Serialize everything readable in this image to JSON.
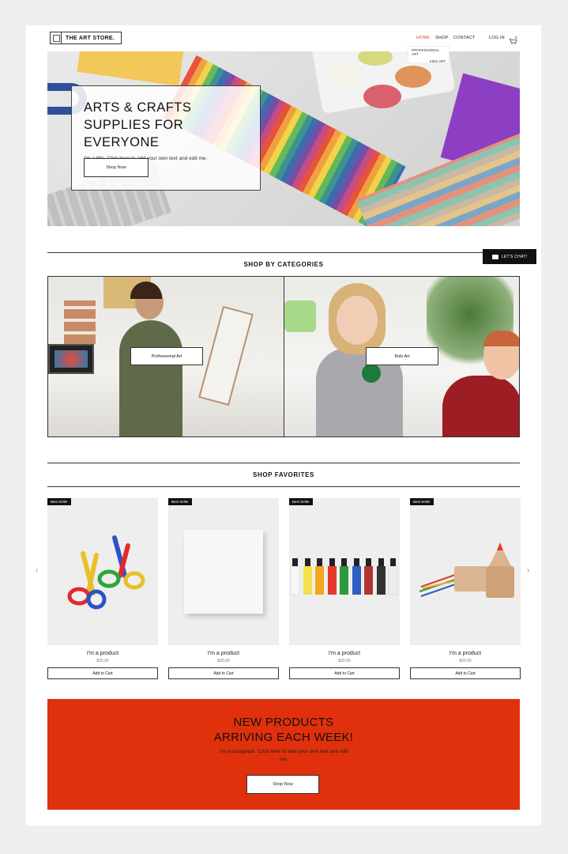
{
  "header": {
    "logo_text": "THE ART STORE.",
    "nav": [
      "HOME",
      "SHOP",
      "CONTACT"
    ],
    "login": "LOG IN",
    "cart_count": "0",
    "dropdown": [
      "PROFESSIONAL ART",
      "KIDS ART"
    ],
    "colors": {
      "accent": "#e0441b"
    }
  },
  "hero": {
    "title": "ARTS & CRAFTS SUPPLIES FOR EVERYONE",
    "subtitle": "I'm a title. Click here to add your own text and edit me.",
    "button": "Shop Now"
  },
  "chat": {
    "label": "LET'S CHAT!",
    "icon": "chat-bubble-icon"
  },
  "categories": {
    "title": "SHOP BY CATEGORIES",
    "items": [
      {
        "label": "Professional Art"
      },
      {
        "label": "Kids Art"
      }
    ]
  },
  "favorites": {
    "title": "SHOP FAVORITES",
    "products": [
      {
        "badge": "Best Seller",
        "name": "I'm a product",
        "price": "$20.00",
        "button": "Add to Cart",
        "image": "scissors"
      },
      {
        "badge": "Best Seller",
        "name": "I'm a product",
        "price": "$20.00",
        "button": "Add to Cart",
        "image": "canvas"
      },
      {
        "badge": "Best Seller",
        "name": "I'm a product",
        "price": "$20.00",
        "button": "Add to Cart",
        "image": "paint-tubes"
      },
      {
        "badge": "Best Seller",
        "name": "I'm a product",
        "price": "$20.00",
        "button": "Add to Cart",
        "image": "pencil-case"
      }
    ],
    "prev_icon": "chevron-left-icon",
    "next_icon": "chevron-right-icon"
  },
  "promo": {
    "title_line1": "NEW PRODUCTS",
    "title_line2": "ARRIVING EACH WEEK!",
    "text": "I'm a paragraph. Click here to add your own text and edit me.",
    "button": "Shop Now",
    "color": "#e0310c"
  }
}
